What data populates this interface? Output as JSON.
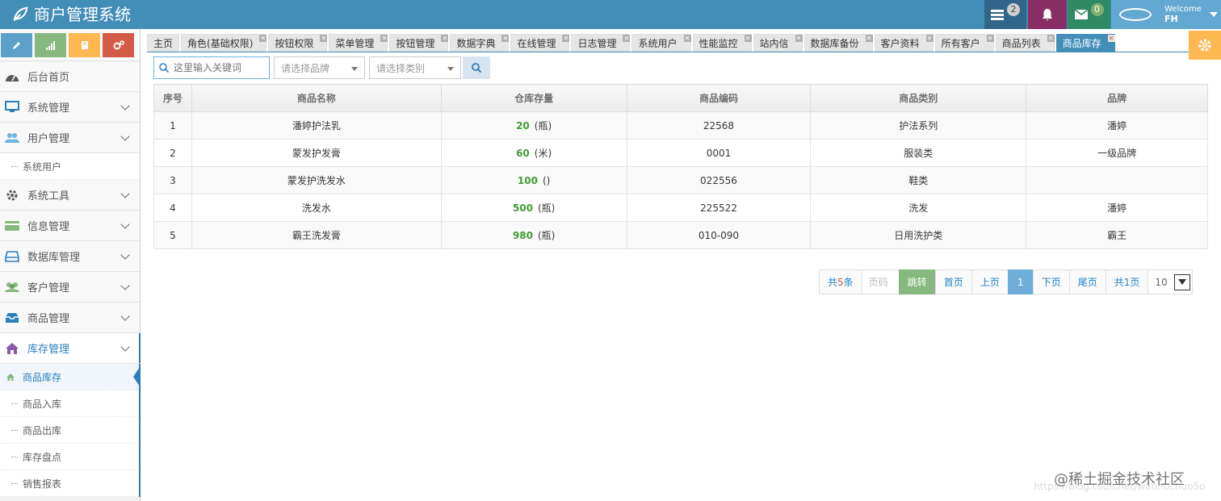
{
  "app": {
    "title": "商户管理系统"
  },
  "navbar": {
    "tasks_count": "2",
    "messages_count": "0",
    "welcome": "Welcome",
    "user": "FH"
  },
  "sidebar": {
    "items": [
      {
        "label": "后台首页"
      },
      {
        "label": "系统管理"
      },
      {
        "label": "用户管理"
      },
      {
        "label": "系统工具"
      },
      {
        "label": "信息管理"
      },
      {
        "label": "数据库管理"
      },
      {
        "label": "客户管理"
      },
      {
        "label": "商品管理"
      },
      {
        "label": "库存管理"
      }
    ],
    "user_sub": [
      "系统用户"
    ],
    "stock_sub": [
      "商品库存",
      "商品入库",
      "商品出库",
      "库存盘点",
      "销售报表"
    ]
  },
  "tabs": [
    "主页",
    "角色(基础权限)",
    "按钮权限",
    "菜单管理",
    "按钮管理",
    "数据字典",
    "在线管理",
    "日志管理",
    "系统用户",
    "性能监控",
    "站内信",
    "数据库备份",
    "客户资料",
    "所有客户",
    "商品列表",
    "商品库存"
  ],
  "toolbar": {
    "search_placeholder": "这里输入关键词",
    "brand_placeholder": "请选择品牌",
    "category_placeholder": "请选择类别"
  },
  "table": {
    "headers": [
      "序号",
      "商品名称",
      "仓库存量",
      "商品编码",
      "商品类别",
      "品牌"
    ],
    "rows": [
      {
        "no": "1",
        "name": "潘婷护法乳",
        "qty": "20",
        "unit": "(瓶)",
        "code": "22568",
        "category": "护法系列",
        "brand": "潘婷"
      },
      {
        "no": "2",
        "name": "蒙发护发膏",
        "qty": "60",
        "unit": "(米)",
        "code": "0001",
        "category": "服装类",
        "brand": "一级品牌"
      },
      {
        "no": "3",
        "name": "蒙发护洗发水",
        "qty": "100",
        "unit": "()",
        "code": "022556",
        "category": "鞋类",
        "brand": ""
      },
      {
        "no": "4",
        "name": "洗发水",
        "qty": "500",
        "unit": "(瓶)",
        "code": "225522",
        "category": "洗发",
        "brand": "潘婷"
      },
      {
        "no": "5",
        "name": "霸王洗发膏",
        "qty": "980",
        "unit": "(瓶)",
        "code": "010-090",
        "category": "日用洗护类",
        "brand": "霸王"
      }
    ]
  },
  "pager": {
    "total_prefix": "共",
    "total_count": "5",
    "total_suffix": "条",
    "page_input_placeholder": "页码",
    "go": "跳转",
    "first": "首页",
    "prev": "上页",
    "current": "1",
    "next": "下页",
    "last": "尾页",
    "total_pages": "共1页",
    "page_size": "10"
  },
  "watermark": {
    "url": "https://blog.csdn.net/wahhuchuo5o",
    "text": "@稀土掘金技术社区"
  },
  "colors": {
    "navbar": "#438eb9",
    "accent": "#2b7dbc",
    "quantity": "#3f9c35"
  }
}
